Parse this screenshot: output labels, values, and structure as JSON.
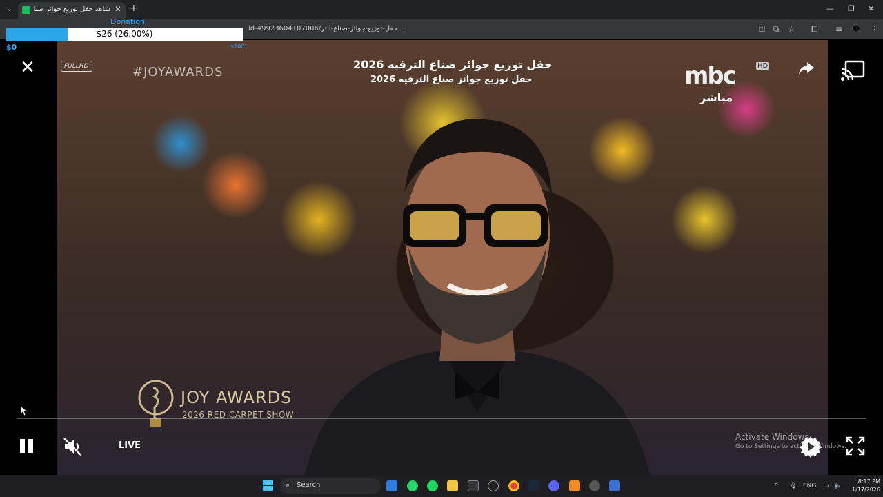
{
  "browser": {
    "tab_title": "شاهد حفل توزيع جوائز صناع التر...",
    "tab_close": "✕",
    "new_tab": "+",
    "url": "id-49923604107006/حفل-توزيع-جوائز-صناع-التر..."
  },
  "donation": {
    "label": "Donation",
    "text": "$26 (26.00%)",
    "progress": 0.26,
    "min": "$0",
    "max": "$100"
  },
  "video": {
    "title_line1": "حفل توزيع جوائز صناع الترفيه 2026",
    "title_line2": "حفل توزيع جوائز صناع الترفيه 2026",
    "hashtag": "#JOYAWARDS",
    "quality_badge": "FULLHD",
    "channel_logo": "mbc",
    "channel_hd": "HD",
    "channel_live": "مباشر",
    "event_name": "JOY AWARDS",
    "event_sub": "2026 RED CARPET SHOW"
  },
  "player": {
    "live_label": "LIVE",
    "progress": 1.0
  },
  "watermark": {
    "line1": "Activate Windows",
    "line2": "Go to Settings to activate Windows."
  },
  "taskbar": {
    "search_label": "Search",
    "lang": "ENG",
    "time": "8:17 PM",
    "date": "1/17/2026"
  }
}
